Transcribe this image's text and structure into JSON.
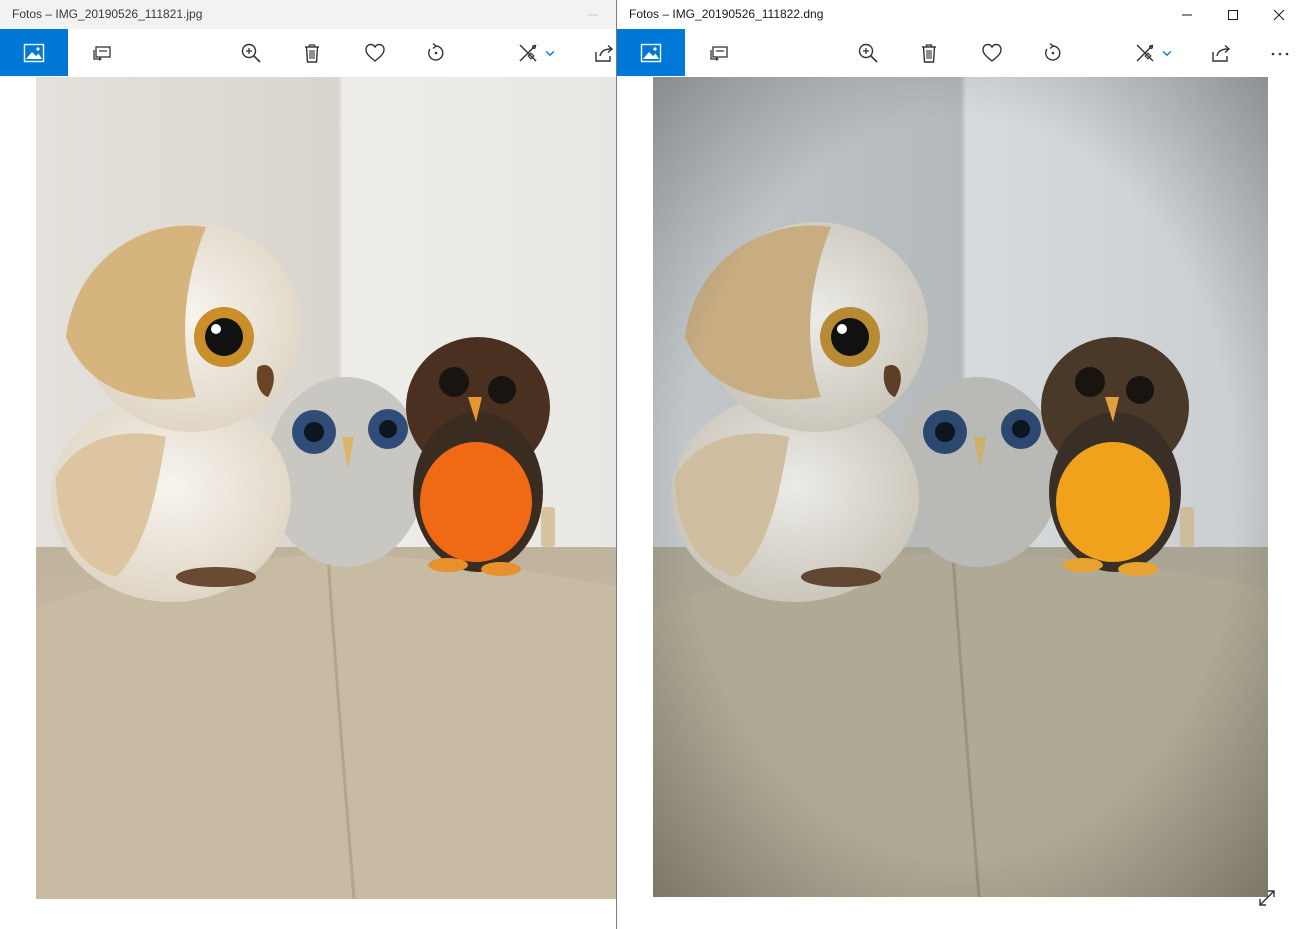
{
  "windows": [
    {
      "title": "Fotos – IMG_20190526_111821.jpg",
      "tone": "warm"
    },
    {
      "title": "Fotos – IMG_20190526_111822.dng",
      "tone": "cool"
    }
  ],
  "toolbar": {
    "icons": [
      "collection-icon",
      "slideshow-icon",
      "zoom-in-icon",
      "delete-icon",
      "favorite-heart-icon",
      "rotate-icon",
      "edit-create-icon",
      "chevron-down-icon",
      "share-icon",
      "more-options-icon"
    ]
  },
  "colors": {
    "accent": "#0078d7",
    "window_border": "#7a7a7a"
  }
}
